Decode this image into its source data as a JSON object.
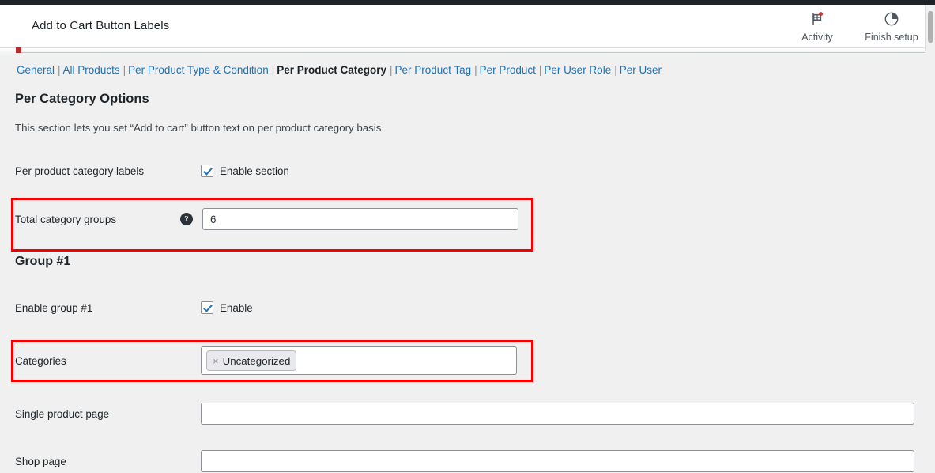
{
  "window": {
    "title": "Add to Cart Button Labels"
  },
  "header": {
    "actions": [
      {
        "label": "Activity",
        "icon": "flag-icon"
      },
      {
        "label": "Finish setup",
        "icon": "pie-progress-icon"
      }
    ]
  },
  "subnav": {
    "separator": "|",
    "items": [
      {
        "label": "General",
        "current": false
      },
      {
        "label": "All Products",
        "current": false
      },
      {
        "label": "Per Product Type & Condition",
        "current": false
      },
      {
        "label": "Per Product Category",
        "current": true
      },
      {
        "label": "Per Product Tag",
        "current": false
      },
      {
        "label": "Per Product",
        "current": false
      },
      {
        "label": "Per User Role",
        "current": false
      },
      {
        "label": "Per User",
        "current": false
      }
    ]
  },
  "section": {
    "title": "Per Category Options",
    "description": "This section lets you set “Add to cart” button text on per product category basis."
  },
  "fields": {
    "enable_section": {
      "label": "Per product category labels",
      "checkbox_label": "Enable section",
      "checked": true
    },
    "total_groups": {
      "label": "Total category groups",
      "help_icon": "question-mark-icon",
      "value": "6",
      "placeholder": ""
    },
    "group_heading": "Group #1",
    "enable_group": {
      "label": "Enable group #1",
      "checkbox_label": "Enable",
      "checked": true
    },
    "categories": {
      "label": "Categories",
      "chips": [
        {
          "remove": "×",
          "text": "Uncategorized"
        }
      ],
      "placeholder": ""
    },
    "single_product_page": {
      "label": "Single product page",
      "value": "",
      "placeholder": ""
    },
    "shop_page": {
      "label": "Shop page",
      "value": "",
      "placeholder": ""
    }
  },
  "highlights": {
    "color": "#f50000",
    "boxes": [
      "total-category-groups-row",
      "categories-row"
    ]
  },
  "colors": {
    "link": "#2271b1",
    "text": "#1d2327",
    "background": "#f0f0f0",
    "accent_red": "#b32d2e",
    "highlight_red": "#f50000"
  }
}
